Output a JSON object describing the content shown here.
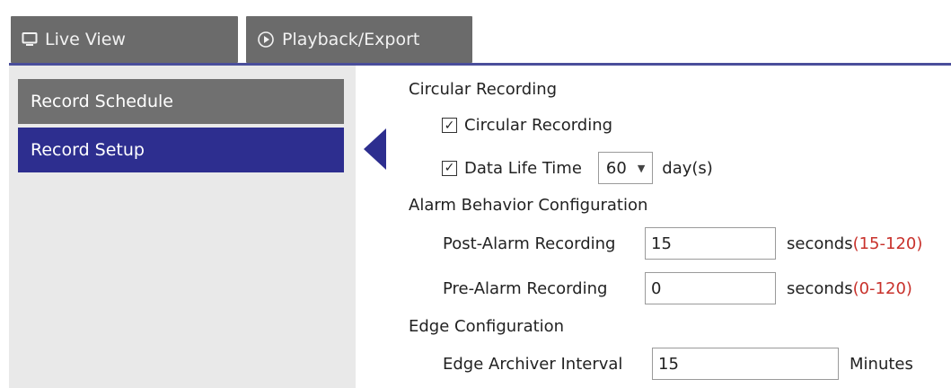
{
  "tabs": [
    {
      "label": "Live View",
      "icon": "monitor-icon"
    },
    {
      "label": "Playback/Export",
      "icon": "play-circle-icon"
    }
  ],
  "sidebar": {
    "items": [
      {
        "label": "Record Schedule",
        "selected": false
      },
      {
        "label": "Record Setup",
        "selected": true
      }
    ]
  },
  "circular": {
    "heading": "Circular Recording",
    "checkbox_label": "Circular Recording",
    "checked": true,
    "data_life_label": "Data Life Time",
    "data_life_checked": true,
    "data_life_value": "60",
    "data_life_unit": "day(s)"
  },
  "alarm": {
    "heading": "Alarm Behavior Configuration",
    "post_label": "Post-Alarm Recording",
    "post_value": "15",
    "post_unit": "seconds",
    "post_range": "(15-120)",
    "pre_label": "Pre-Alarm Recording",
    "pre_value": "0",
    "pre_unit": "seconds",
    "pre_range": "(0-120)"
  },
  "edge": {
    "heading": "Edge Configuration",
    "interval_label": "Edge Archiver Interval",
    "interval_value": "15",
    "interval_unit": "Minutes"
  },
  "colors": {
    "tab_bg": "#6b6b6b",
    "accent": "#2d2e8f",
    "range_red": "#c8312b"
  }
}
